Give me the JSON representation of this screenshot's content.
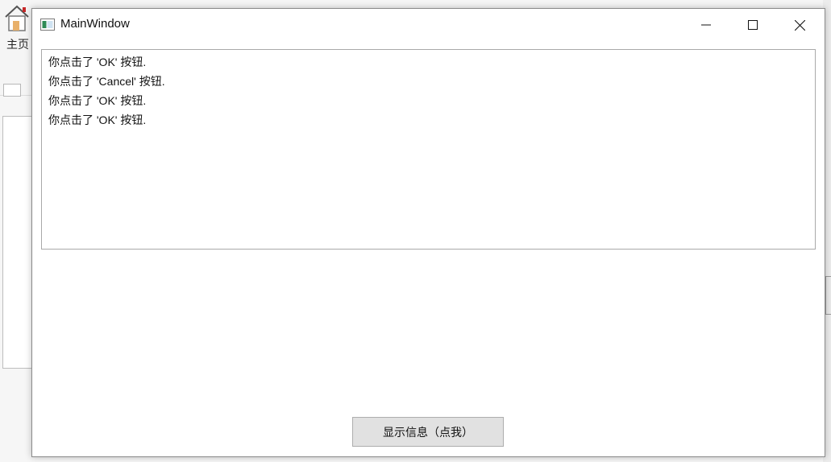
{
  "background_app": {
    "home_label": "主页"
  },
  "window": {
    "title": "MainWindow",
    "controls": {
      "minimize_icon": "minimize-icon",
      "maximize_icon": "maximize-icon",
      "close_icon": "close-icon"
    }
  },
  "log": {
    "lines": [
      "你点击了 'OK' 按钮.",
      "你点击了 'Cancel' 按钮.",
      "你点击了 'OK' 按钮.",
      "你点击了 'OK' 按钮."
    ]
  },
  "action_button": {
    "label": "显示信息（点我）"
  },
  "colors": {
    "window_bg": "#ffffff",
    "button_bg": "#e1e1e1",
    "border": "#a9a9a9"
  }
}
